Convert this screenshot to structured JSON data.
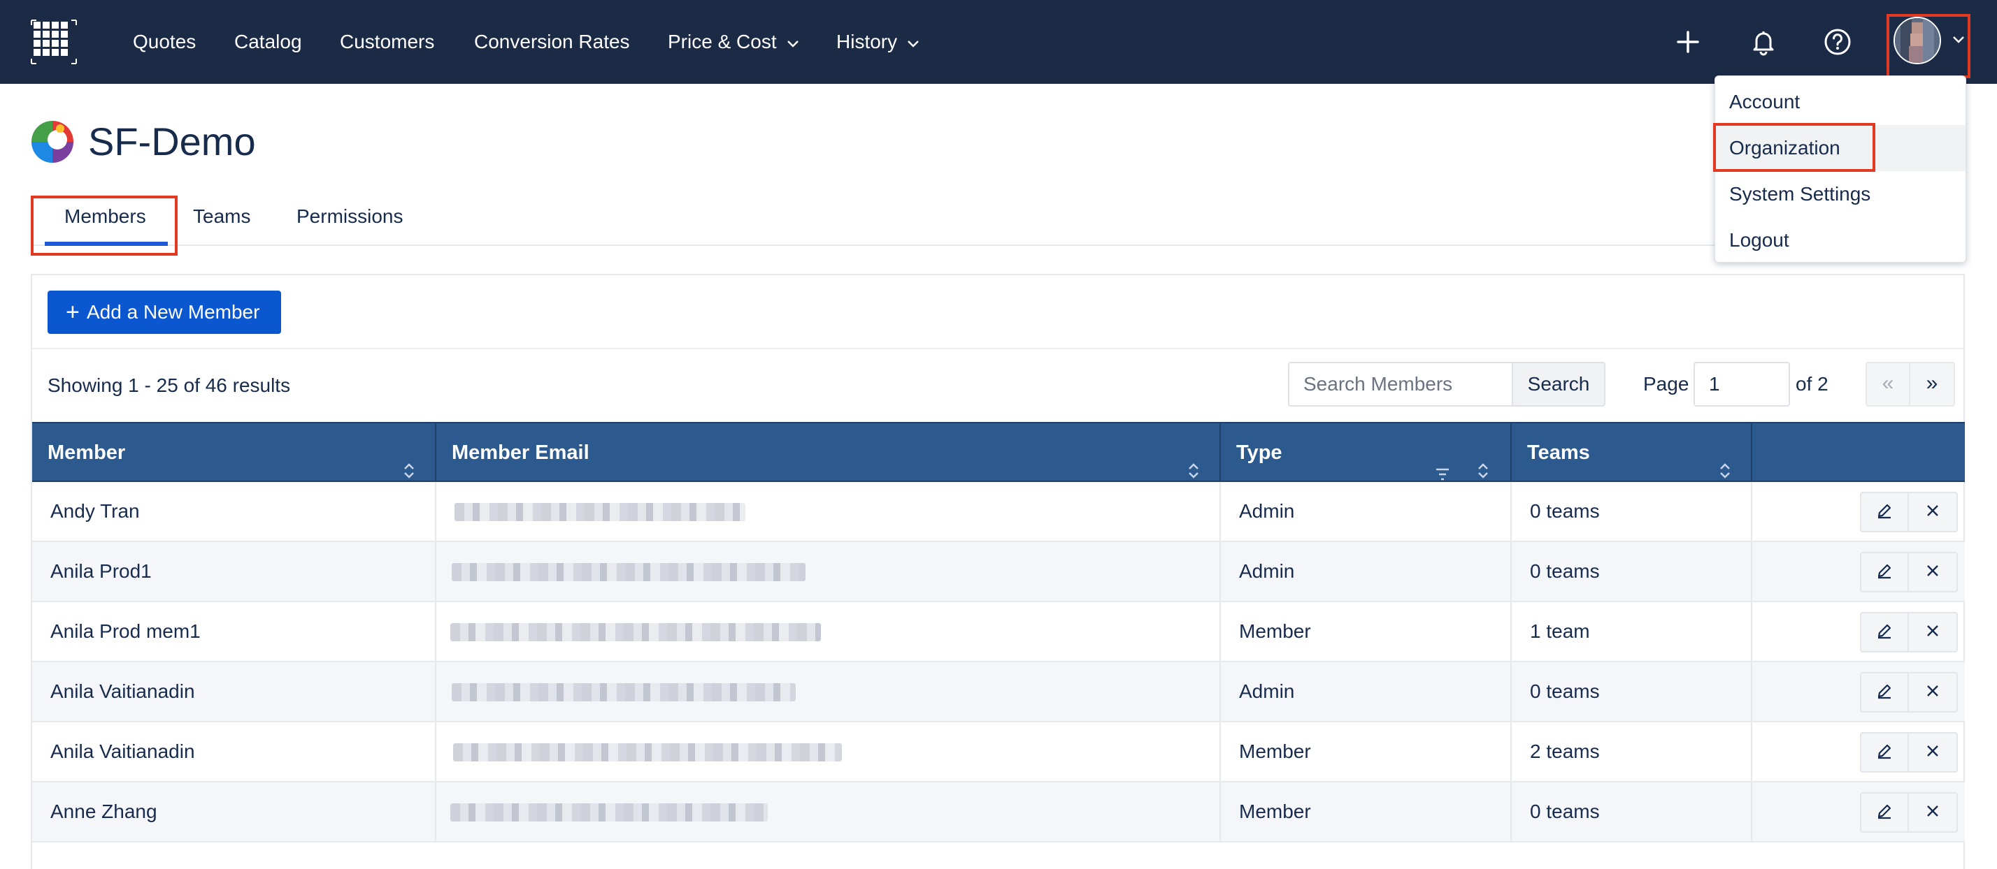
{
  "nav": {
    "items": [
      {
        "label": "Quotes"
      },
      {
        "label": "Catalog"
      },
      {
        "label": "Customers"
      },
      {
        "label": "Conversion Rates"
      },
      {
        "label": "Price & Cost"
      },
      {
        "label": "History"
      }
    ],
    "icons": [
      "grid-logo-icon",
      "plus-icon",
      "bell-icon",
      "help-icon",
      "avatar",
      "chevron-down-icon"
    ]
  },
  "user_menu": {
    "items": [
      {
        "label": "Account"
      },
      {
        "label": "Organization"
      },
      {
        "label": "System Settings"
      },
      {
        "label": "Logout"
      }
    ],
    "active": "Organization"
  },
  "org": {
    "title": "SF-Demo"
  },
  "tabs": [
    {
      "label": "Members"
    },
    {
      "label": "Teams"
    },
    {
      "label": "Permissions"
    }
  ],
  "active_tab": "Members",
  "toolbar": {
    "add_label": "Add a New Member",
    "results_text": "Showing 1 - 25 of 46 results",
    "search_placeholder": "Search Members",
    "search_label": "Search",
    "page_label": "Page",
    "page_value": "1",
    "page_of": "of 2",
    "prev_label": "«",
    "next_label": "»"
  },
  "table": {
    "columns": [
      {
        "label": "Member"
      },
      {
        "label": "Member Email"
      },
      {
        "label": "Type"
      },
      {
        "label": "Teams"
      }
    ],
    "rows": [
      {
        "member": "Andy Tran",
        "type": "Admin",
        "teams": "0 teams"
      },
      {
        "member": "Anila Prod1",
        "type": "Admin",
        "teams": "0 teams"
      },
      {
        "member": "Anila Prod mem1",
        "type": "Member",
        "teams": "1 team"
      },
      {
        "member": "Anila Vaitianadin",
        "type": "Admin",
        "teams": "0 teams"
      },
      {
        "member": "Anila Vaitianadin",
        "type": "Member",
        "teams": "2 teams"
      },
      {
        "member": "Anne Zhang",
        "type": "Member",
        "teams": "0 teams"
      }
    ]
  },
  "colors": {
    "nav_bg": "#1b2a45",
    "primary": "#0b57d0",
    "table_header": "#2d5a8e",
    "highlight": "#e23a22"
  }
}
